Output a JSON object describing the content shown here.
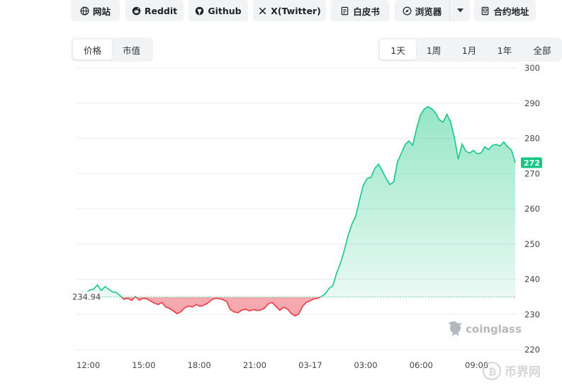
{
  "links": [
    {
      "label": "网站",
      "icon": "globe-icon"
    },
    {
      "label": "Reddit",
      "icon": "reddit-icon"
    },
    {
      "label": "Github",
      "icon": "github-icon"
    },
    {
      "label": "X(Twitter)",
      "icon": "x-icon"
    },
    {
      "label": "白皮书",
      "icon": "document-icon"
    },
    {
      "label": "浏览器",
      "icon": "compass-icon"
    },
    {
      "label": "合约地址",
      "icon": "contract-icon"
    }
  ],
  "metric_tabs": [
    {
      "label": "价格",
      "active": true
    },
    {
      "label": "市值",
      "active": false
    }
  ],
  "range_tabs": [
    {
      "label": "1天",
      "active": true
    },
    {
      "label": "1周",
      "active": false
    },
    {
      "label": "1月",
      "active": false
    },
    {
      "label": "1年",
      "active": false
    },
    {
      "label": "全部",
      "active": false
    }
  ],
  "baseline_label": "234.94",
  "current_label": "272",
  "watermark": "coinglass",
  "corner_watermark": "币界网",
  "colors": {
    "up": "#16c784",
    "down": "#ea3943",
    "current_badge": "#16c784"
  },
  "chart_data": {
    "type": "area",
    "title": "",
    "xlabel": "",
    "ylabel": "",
    "ylim": [
      220,
      300
    ],
    "y_ticks": [
      220,
      230,
      240,
      250,
      260,
      270,
      280,
      290,
      300
    ],
    "x_ticks": [
      "12:00",
      "15:00",
      "18:00",
      "21:00",
      "03-17",
      "03:00",
      "06:00",
      "09:00"
    ],
    "baseline": 234.94,
    "grid": true,
    "series": [
      {
        "values": [
          236.5,
          236.3,
          236.9,
          237.2,
          238.4,
          236.8,
          237.9,
          237.1,
          236.4,
          236.2,
          235.3,
          234.3,
          234.6,
          234.0,
          235.1,
          234.1,
          234.6,
          234.5,
          233.8,
          233.2,
          232.8,
          233.4,
          232.1,
          231.7,
          231.0,
          230.2,
          230.8,
          231.9,
          232.4,
          232.1,
          232.8,
          232.3,
          232.6,
          233.2,
          234.1,
          234.6,
          234.5,
          234.2,
          233.7,
          231.4,
          230.7,
          230.5,
          231.2,
          231.5,
          231.0,
          231.4,
          231.1,
          231.3,
          231.8,
          233.0,
          233.4,
          232.3,
          231.2,
          232.0,
          231.6,
          230.3,
          229.6,
          230.1,
          232.3,
          233.4,
          233.9,
          234.4,
          234.6,
          235.1,
          235.9,
          237.4,
          238.2,
          241.8,
          244.6,
          248.2,
          252.4,
          255.6,
          257.9,
          262.5,
          266.7,
          268.6,
          268.9,
          271.4,
          272.7,
          270.8,
          268.6,
          266.9,
          267.6,
          273.4,
          275.7,
          278.2,
          279.3,
          278.1,
          282.6,
          286.5,
          288.3,
          289.0,
          288.4,
          287.3,
          285.3,
          284.6,
          286.9,
          284.6,
          280.2,
          274.1,
          278.4,
          276.4,
          275.8,
          276.6,
          275.6,
          275.9,
          277.6,
          276.8,
          278.0,
          278.3,
          277.8,
          279.0,
          277.6,
          276.7,
          273.1
        ]
      }
    ]
  }
}
